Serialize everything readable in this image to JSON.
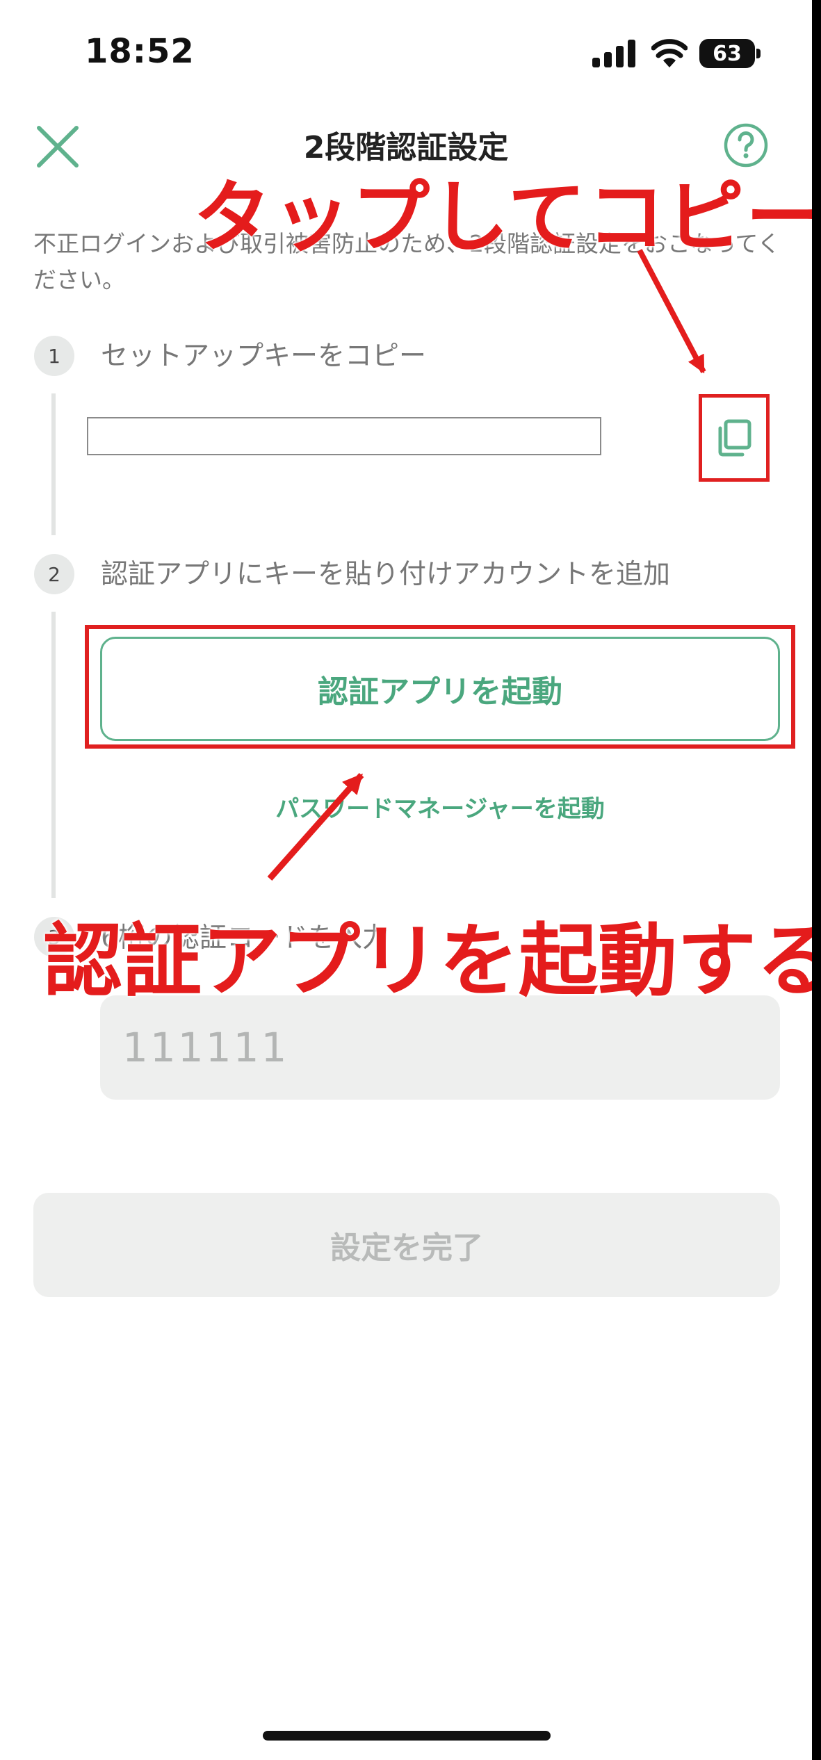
{
  "status_bar": {
    "time": "18:52",
    "battery": "63"
  },
  "header": {
    "title": "2段階認証設定",
    "close_icon": "close-icon",
    "help_icon": "help-icon"
  },
  "description": "不正ログインおよび取引被害防止のため、2段階認証設定をおこなってください。",
  "steps": [
    {
      "number": "1",
      "label": "セットアップキーをコピー"
    },
    {
      "number": "2",
      "label": "認証アプリにキーを貼り付けアカウントを追加"
    },
    {
      "number": "3",
      "label": "6桁の認証コードを入力"
    }
  ],
  "setup_key": {
    "value": "",
    "copy_icon": "copy-icon"
  },
  "buttons": {
    "launch_auth_app": "認証アプリを起動",
    "launch_password_manager": "パスワードマネージャーを起動",
    "complete": "設定を完了"
  },
  "code_input": {
    "placeholder": "111111"
  },
  "annotations": {
    "tap_copy": "タップしてコピー",
    "launch_app": "認証アプリを起動する"
  },
  "colors": {
    "accent_green": "#4aa77e",
    "annotation_red": "#e41c1c",
    "disabled_bg": "#eeefee"
  }
}
